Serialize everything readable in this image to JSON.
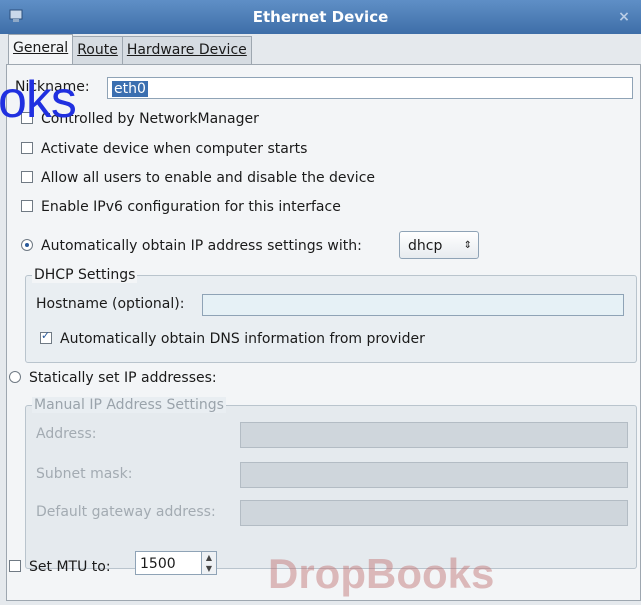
{
  "window": {
    "title": "Ethernet Device",
    "close_glyph": "×"
  },
  "tabs": [
    {
      "label": "General",
      "active": true
    },
    {
      "label": "Route",
      "active": false
    },
    {
      "label": "Hardware Device",
      "active": false
    }
  ],
  "nickname": {
    "label": "Nickname:",
    "value": "eth0"
  },
  "checks": [
    {
      "label": "Controlled by NetworkManager",
      "checked": false
    },
    {
      "label": "Activate device when computer starts",
      "checked": false
    },
    {
      "label": "Allow all users to enable and disable the device",
      "checked": false
    },
    {
      "label": "Enable IPv6 configuration for this interface",
      "checked": false
    }
  ],
  "auto_ip": {
    "label": "Automatically obtain IP address settings with:",
    "selected": true,
    "method": "dhcp"
  },
  "dhcp": {
    "legend": "DHCP Settings",
    "hostname_label": "Hostname (optional):",
    "hostname_value": "",
    "dns_label": "Automatically obtain DNS information from provider",
    "dns_checked": true
  },
  "static_ip": {
    "label": "Statically set IP addresses:",
    "selected": false
  },
  "manual": {
    "legend": "Manual IP Address Settings",
    "address_label": "Address:",
    "subnet_label": "Subnet mask:",
    "gateway_label": "Default gateway address:"
  },
  "mtu": {
    "label": "Set MTU to:",
    "value": "1500",
    "checked": false
  },
  "watermark": {
    "top_text": "oks",
    "bottom_text": "DropBooks"
  }
}
